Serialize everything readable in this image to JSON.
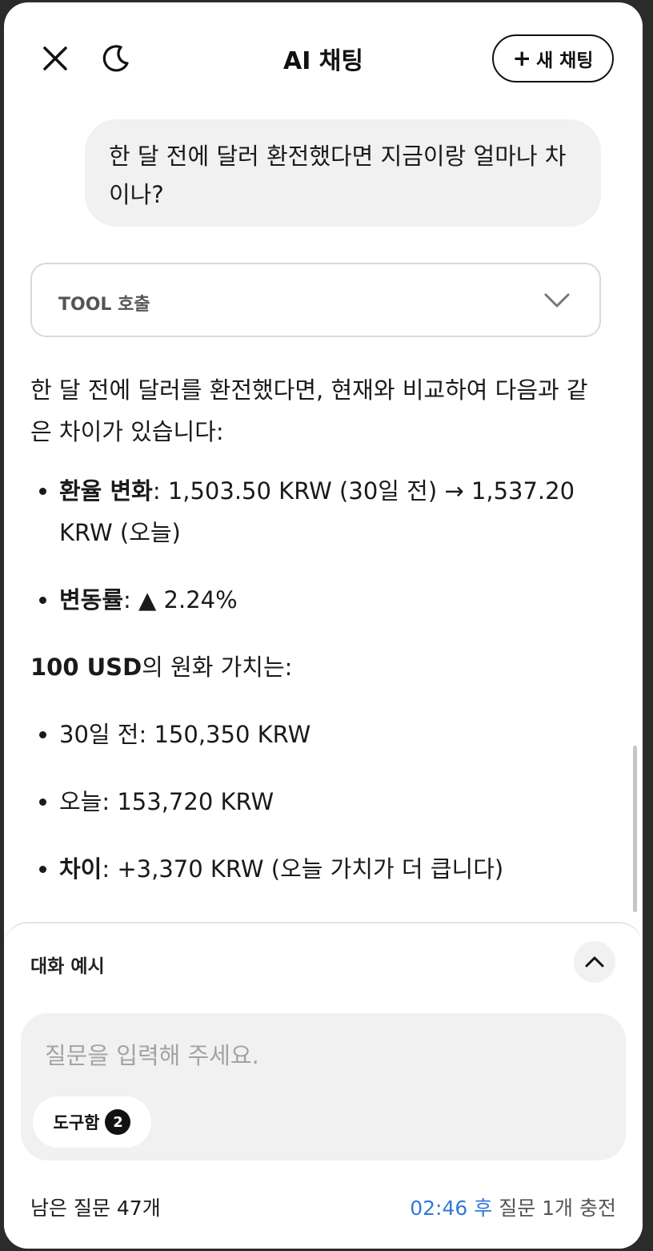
{
  "header": {
    "title": "AI 채팅",
    "new_chat_label": "새 채팅",
    "new_chat_icon": "+"
  },
  "conversation": {
    "user_message": "한 달 전에 달러 환전했다면 지금이랑 얼마나 차이나?",
    "tool_call_label": "TOOL 호출",
    "answer": {
      "intro": "한 달 전에 달러를 환전했다면, 현재와 비교하여 다음과 같은 차이가 있습니다:",
      "bullets1": [
        {
          "bold": "환율 변화",
          "text": ": 1,503.50 KRW (30일 전) → 1,537.20 KRW (오늘)"
        },
        {
          "bold": "변동률",
          "text": ": ▲ 2.24%"
        }
      ],
      "value_heading_bold": "100 USD",
      "value_heading_text": "의 원화 가치는:",
      "bullets2": [
        {
          "bold": "",
          "text": "30일 전: 150,350 KRW"
        },
        {
          "bold": "",
          "text": "오늘: 153,720 KRW"
        },
        {
          "bold": "차이",
          "text": ": +3,370 KRW (오늘 가치가 더 큽니다)"
        }
      ]
    }
  },
  "composer": {
    "examples_label": "대화 예시",
    "input_placeholder": "질문을 입력해 주세요.",
    "toolbox_label": "도구함",
    "toolbox_count": "2",
    "remaining_label": "남은 질문 47개",
    "recharge_time": "02:46 후",
    "recharge_text": " 질문 1개 충전"
  },
  "colors": {
    "accent_blue": "#3478d8",
    "bubble_gray": "#f1f1f1"
  },
  "icons": {
    "close": "close-icon",
    "theme": "moon-icon",
    "tool_expand": "chevron-down-icon",
    "examples_collapse": "chevron-up-icon"
  }
}
